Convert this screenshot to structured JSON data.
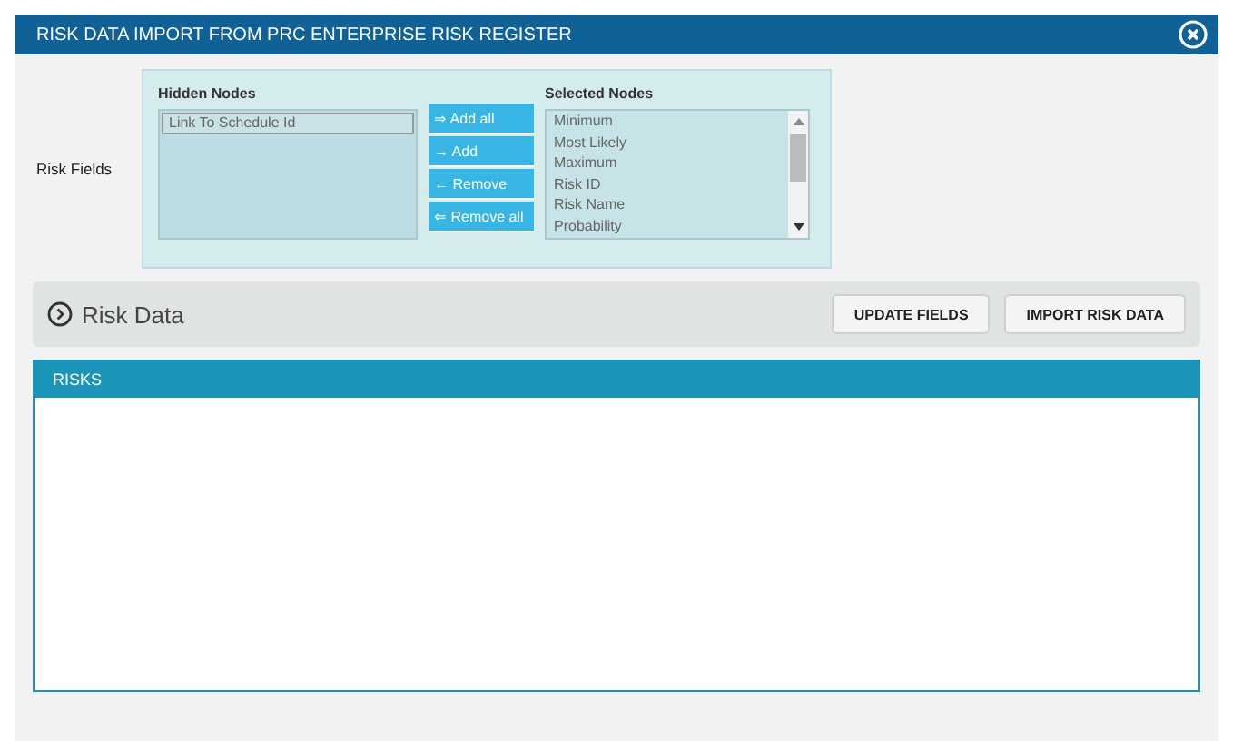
{
  "window": {
    "title": "RISK DATA IMPORT FROM PRC ENTERPRISE RISK REGISTER"
  },
  "risk_fields": {
    "label": "Risk Fields",
    "hidden_nodes": {
      "title": "Hidden Nodes",
      "items": [
        {
          "label": "Link To Schedule Id",
          "selected": true
        }
      ]
    },
    "buttons": [
      {
        "label": "⇒ Add all"
      },
      {
        "label": "→ Add"
      },
      {
        "label": "← Remove"
      },
      {
        "label": "⇐ Remove all"
      }
    ],
    "selected_nodes": {
      "title": "Selected Nodes",
      "items": [
        {
          "label": "Minimum",
          "selected": false
        },
        {
          "label": "Most Likely",
          "selected": false
        },
        {
          "label": "Maximum",
          "selected": false
        },
        {
          "label": "Risk ID",
          "selected": false
        },
        {
          "label": "Risk Name",
          "selected": false
        },
        {
          "label": "Probability",
          "selected": false
        }
      ]
    }
  },
  "risk_data": {
    "title": "Risk Data",
    "buttons": [
      "UPDATE FIELDS",
      "IMPORT RISK DATA"
    ]
  },
  "risks": {
    "title": "RISKS"
  }
}
